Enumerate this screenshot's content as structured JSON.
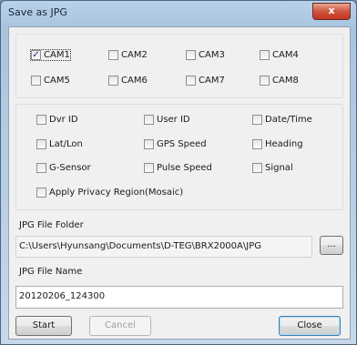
{
  "window": {
    "title": "Save as JPG",
    "close_glyph": "x"
  },
  "cameras": [
    {
      "label": "CAM1",
      "checked": true
    },
    {
      "label": "CAM2",
      "checked": false
    },
    {
      "label": "CAM3",
      "checked": false
    },
    {
      "label": "CAM4",
      "checked": false
    },
    {
      "label": "CAM5",
      "checked": false
    },
    {
      "label": "CAM6",
      "checked": false
    },
    {
      "label": "CAM7",
      "checked": false
    },
    {
      "label": "CAM8",
      "checked": false
    }
  ],
  "overlay_options": [
    {
      "label": "Dvr ID",
      "checked": false
    },
    {
      "label": "User ID",
      "checked": false
    },
    {
      "label": "Date/Time",
      "checked": false
    },
    {
      "label": "Lat/Lon",
      "checked": false
    },
    {
      "label": "GPS Speed",
      "checked": false
    },
    {
      "label": "Heading",
      "checked": false
    },
    {
      "label": "G-Sensor",
      "checked": false
    },
    {
      "label": "Pulse Speed",
      "checked": false
    },
    {
      "label": "Signal",
      "checked": false
    },
    {
      "label": "Apply Privacy Region(Mosaic)",
      "checked": false
    }
  ],
  "folder": {
    "label": "JPG File Folder",
    "value": "C:\\Users\\Hyunsang\\Documents\\D-TEG\\BRX2000A\\JPG",
    "browse_label": "..."
  },
  "file_name": {
    "label": "JPG File Name",
    "value": "20120206_124300"
  },
  "buttons": {
    "start": "Start",
    "cancel": "Cancel",
    "close": "Close"
  },
  "check_glyph": "✓"
}
